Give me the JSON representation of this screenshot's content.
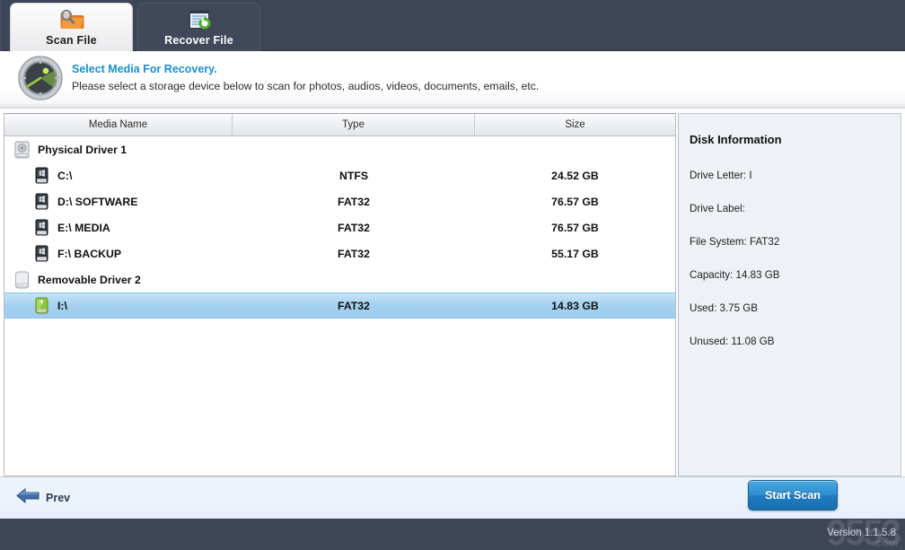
{
  "tabs": [
    {
      "label": "Scan File",
      "icon": "folder-search-icon",
      "active": true
    },
    {
      "label": "Recover File",
      "icon": "document-refresh-icon",
      "active": false
    }
  ],
  "header": {
    "icon": "radar-scanner-icon",
    "title": "Select Media For Recovery.",
    "subtitle": "Please select a storage device below to scan for photos, audios, videos, documents, emails, etc."
  },
  "table": {
    "columns": [
      "Media Name",
      "Type",
      "Size"
    ],
    "rows": [
      {
        "name": "Physical Driver 1",
        "type": "",
        "size": "",
        "level": "group",
        "icon": "hard-disk-icon",
        "selected": false
      },
      {
        "name": "C:\\",
        "type": "NTFS",
        "size": "24.52 GB",
        "level": "child",
        "icon": "windows-drive-icon",
        "selected": false
      },
      {
        "name": "D:\\ SOFTWARE",
        "type": "FAT32",
        "size": "76.57 GB",
        "level": "child",
        "icon": "windows-drive-icon",
        "selected": false
      },
      {
        "name": "E:\\ MEDIA",
        "type": "FAT32",
        "size": "76.57 GB",
        "level": "child",
        "icon": "windows-drive-icon",
        "selected": false
      },
      {
        "name": "F:\\ BACKUP",
        "type": "FAT32",
        "size": "55.17 GB",
        "level": "child",
        "icon": "windows-drive-icon",
        "selected": false
      },
      {
        "name": "Removable Driver 2",
        "type": "",
        "size": "",
        "level": "group",
        "icon": "removable-disk-icon",
        "selected": false
      },
      {
        "name": "I:\\",
        "type": "FAT32",
        "size": "14.83 GB",
        "level": "child",
        "icon": "usb-drive-green-icon",
        "selected": true
      }
    ]
  },
  "disk_info": {
    "title": "Disk Information",
    "lines": [
      "Drive Letter: I",
      "Drive Label:",
      "File System: FAT32",
      "Capacity: 14.83 GB",
      "Used: 3.75 GB",
      "Unused: 11.08 GB"
    ]
  },
  "footer": {
    "prev_label": "Prev",
    "prev_icon": "arrow-left-icon",
    "start_scan_label": "Start Scan"
  },
  "status": {
    "version": "Version 1.1.5.8",
    "watermark": "9553",
    "watermark_sub": ".com"
  },
  "colors": {
    "chrome_dark": "#3e4557",
    "accent_blue": "#1a8fd0",
    "selection_blue": "#a4d1ef",
    "panel_bg": "#eef2f7",
    "button_blue": "#2e8fd0"
  }
}
